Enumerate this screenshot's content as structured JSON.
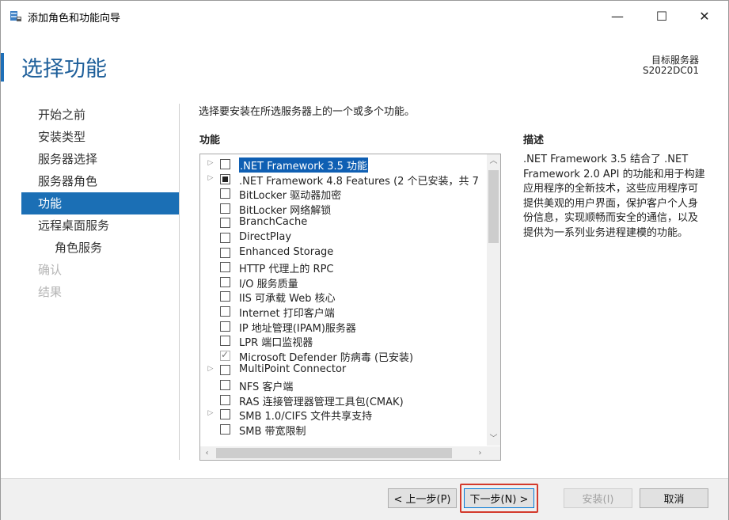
{
  "window": {
    "title": "添加角色和功能向导",
    "icon": "server-manager-icon",
    "controls": {
      "minimize": "—",
      "maximize": "☐",
      "close": "✕"
    }
  },
  "header": {
    "title": "选择功能",
    "target_label": "目标服务器",
    "target_value": "S2022DC01"
  },
  "nav": {
    "items": [
      {
        "label": "开始之前",
        "state": "normal"
      },
      {
        "label": "安装类型",
        "state": "normal"
      },
      {
        "label": "服务器选择",
        "state": "normal"
      },
      {
        "label": "服务器角色",
        "state": "normal"
      },
      {
        "label": "功能",
        "state": "active"
      },
      {
        "label": "远程桌面服务",
        "state": "normal"
      },
      {
        "label": "角色服务",
        "state": "sub"
      },
      {
        "label": "确认",
        "state": "disabled"
      },
      {
        "label": "结果",
        "state": "disabled"
      }
    ]
  },
  "main": {
    "instruction": "选择要安装在所选服务器上的一个或多个功能。",
    "features_label": "功能",
    "features": [
      {
        "label": ".NET Framework 3.5 功能",
        "expandable": true,
        "check": "none",
        "selected": true
      },
      {
        "label": ".NET Framework 4.8 Features (2 个已安装，共 7",
        "expandable": true,
        "check": "partial",
        "selected": false
      },
      {
        "label": "BitLocker 驱动器加密",
        "expandable": false,
        "check": "none",
        "selected": false
      },
      {
        "label": "BitLocker 网络解锁",
        "expandable": false,
        "check": "none",
        "selected": false
      },
      {
        "label": "BranchCache",
        "expandable": false,
        "check": "none",
        "selected": false
      },
      {
        "label": "DirectPlay",
        "expandable": false,
        "check": "none",
        "selected": false
      },
      {
        "label": "Enhanced Storage",
        "expandable": false,
        "check": "none",
        "selected": false
      },
      {
        "label": "HTTP 代理上的 RPC",
        "expandable": false,
        "check": "none",
        "selected": false
      },
      {
        "label": "I/O 服务质量",
        "expandable": false,
        "check": "none",
        "selected": false
      },
      {
        "label": "IIS 可承载 Web 核心",
        "expandable": false,
        "check": "none",
        "selected": false
      },
      {
        "label": "Internet 打印客户端",
        "expandable": false,
        "check": "none",
        "selected": false
      },
      {
        "label": "IP 地址管理(IPAM)服务器",
        "expandable": false,
        "check": "none",
        "selected": false
      },
      {
        "label": "LPR 端口监视器",
        "expandable": false,
        "check": "none",
        "selected": false
      },
      {
        "label": "Microsoft Defender 防病毒 (已安装)",
        "expandable": false,
        "check": "checked",
        "selected": false
      },
      {
        "label": "MultiPoint Connector",
        "expandable": true,
        "check": "none",
        "selected": false
      },
      {
        "label": "NFS 客户端",
        "expandable": false,
        "check": "none",
        "selected": false
      },
      {
        "label": "RAS 连接管理器管理工具包(CMAK)",
        "expandable": false,
        "check": "none",
        "selected": false
      },
      {
        "label": "SMB 1.0/CIFS 文件共享支持",
        "expandable": true,
        "check": "none",
        "selected": false
      },
      {
        "label": "SMB 带宽限制",
        "expandable": false,
        "check": "none",
        "selected": false
      }
    ],
    "description_label": "描述",
    "description_text": ".NET Framework 3.5 结合了 .NET Framework 2.0 API 的功能和用于构建应用程序的全新技术，这些应用程序可提供美观的用户界面，保护客户个人身份信息，实现顺畅而安全的通信，以及提供为一系列业务进程建模的功能。"
  },
  "footer": {
    "prev": "< 上一步(P)",
    "next": "下一步(N) >",
    "install": "安装(I)",
    "cancel": "取消"
  },
  "colors": {
    "accent": "#1b6fb5",
    "highlight_box": "#d33a2c"
  }
}
